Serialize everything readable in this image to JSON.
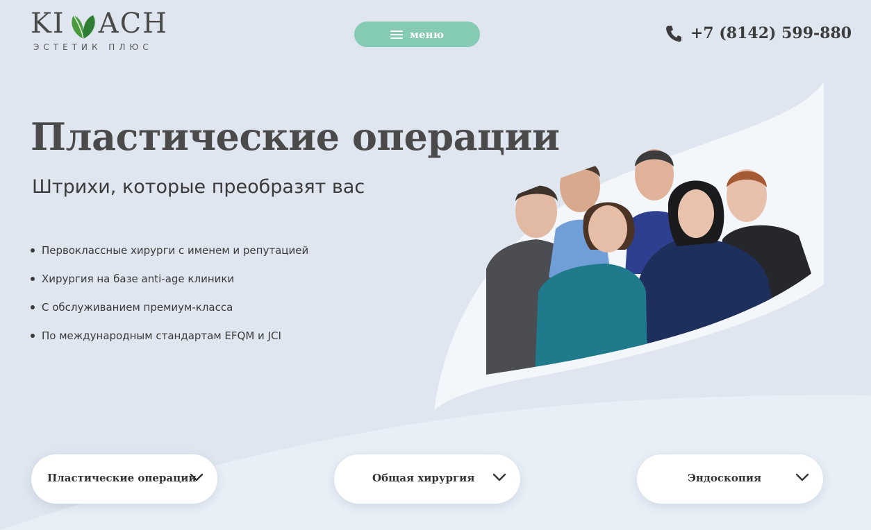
{
  "header": {
    "logo_text": "KI ACH",
    "logo_subtitle": "ЭСТЕТИК ПЛЮС",
    "menu_label": "меню",
    "phone": "+7 (8142) 599-880"
  },
  "hero": {
    "title": "Пластические операции",
    "subtitle": "Штрихи, которые преобразят вас",
    "bullets": [
      "Первоклассные хирурги с именем и репутацией",
      "Хирургия на базе anti-age клиники",
      "С обслуживанием премиум-класса",
      "По международным стандартам EFQM и JCI"
    ]
  },
  "categories": [
    {
      "label": "Пластические операции"
    },
    {
      "label": "Общая хирургия"
    },
    {
      "label": "Эндоскопия"
    }
  ],
  "colors": {
    "background": "#dfe6f0",
    "accent": "#85cab2",
    "brand_green": "#3d8f3a",
    "text": "#3a3a3a"
  },
  "icons": {
    "menu": "hamburger-icon",
    "phone": "phone-icon",
    "dropdown": "chevron-down-icon",
    "logo": "leaf-icon"
  }
}
